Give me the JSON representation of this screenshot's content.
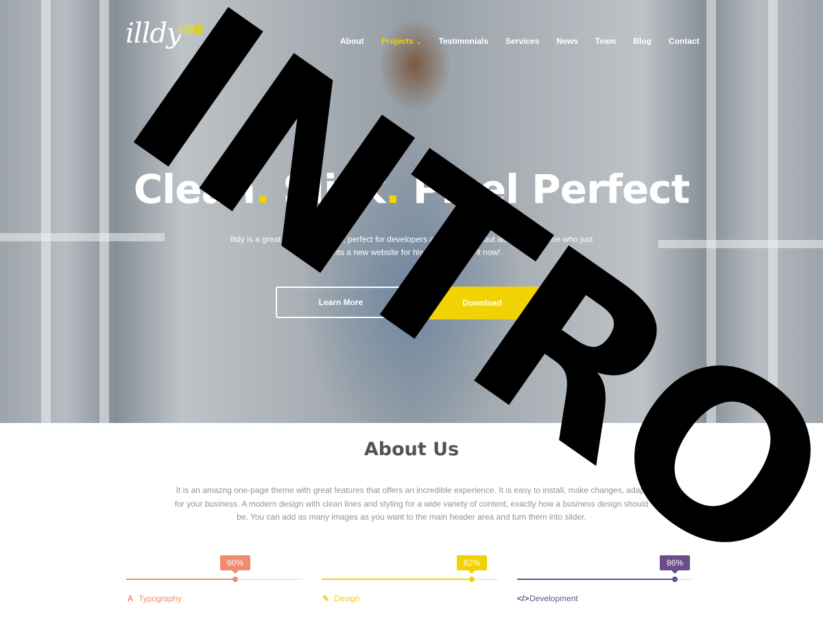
{
  "logo": {
    "text": "illdy",
    "dot_colors": [
      "#c9c9a0",
      "#d4d36e",
      "#d6d32a"
    ]
  },
  "nav": {
    "items": [
      {
        "label": "About",
        "active": false
      },
      {
        "label": "Projects",
        "active": true,
        "has_dropdown": true
      },
      {
        "label": "Testimonials",
        "active": false
      },
      {
        "label": "Services",
        "active": false
      },
      {
        "label": "News",
        "active": false
      },
      {
        "label": "Team",
        "active": false
      },
      {
        "label": "Blog",
        "active": false
      },
      {
        "label": "Contact",
        "active": false
      }
    ]
  },
  "hero": {
    "title_part1": "Clean",
    "title_dot1": ".",
    "title_part2": " Slick",
    "title_dot2": ".",
    "title_part3": " Pixel Perfect",
    "subtitle": "Illdy is a great one-page theme, perfect for developers and designers but also for someone who just wants a new website for his business. Try it now!",
    "primary_button": "Learn More",
    "secondary_button": "Download"
  },
  "overlay": {
    "text": "INTRO"
  },
  "about": {
    "title": "About Us",
    "text": "It is an amazng one-page theme with great features that offers an incredible experience. It is easy to install, make changes, adapt for your business. A modern design with clean lines and styling for a wide variety of content, exactly how a business design should be. You can add as many images as you want to the main header area and turn them into slider."
  },
  "skills": [
    {
      "label": "Typography",
      "percent_label": "60%",
      "value": 0.6,
      "color": "#f18b6d",
      "icon": "typography-icon",
      "glyph": "A"
    },
    {
      "label": "Design",
      "percent_label": "82%",
      "value": 0.82,
      "color": "#f1d204",
      "icon": "pencil-icon",
      "glyph": "✎"
    },
    {
      "label": "Development",
      "percent_label": "86%",
      "value": 0.86,
      "color": "#6a4d8a",
      "icon": "code-icon",
      "glyph": "</>"
    }
  ],
  "colors": {
    "accent_yellow": "#f1d204",
    "heading": "#545454",
    "body_text": "#8c9597"
  }
}
